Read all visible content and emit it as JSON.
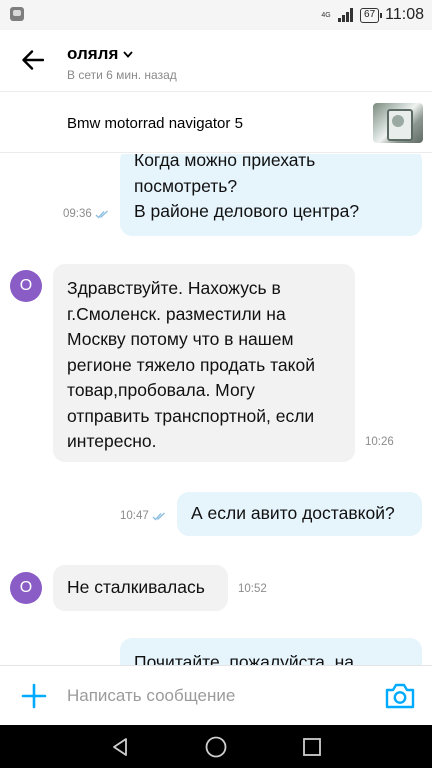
{
  "status_bar": {
    "network": "4G",
    "battery": "67",
    "time": "11:08"
  },
  "header": {
    "contact_name": "оляля",
    "online_status": "В сети 6 мин. назад"
  },
  "item": {
    "title": "Bmw motorrad navigator 5"
  },
  "messages": [
    {
      "direction": "out",
      "lines": [
        "Когда можно приехать",
        "посмотреть?",
        "В районе делового центра?"
      ],
      "time": "09:36",
      "read": true
    },
    {
      "direction": "in",
      "avatar_letter": "О",
      "lines": [
        "Здравствуйте. Нахожусь в",
        "г.Смоленск. разместили на",
        "Москву потому что в нашем",
        "регионе тяжело продать такой",
        "товар,пробовала. Могу",
        "отправить транспортной, если",
        "интересно."
      ],
      "time": "10:26"
    },
    {
      "direction": "out",
      "lines": [
        "А если авито доставкой?"
      ],
      "time": "10:47",
      "read": true
    },
    {
      "direction": "in",
      "avatar_letter": "О",
      "lines": [
        "Не сталкивалась"
      ],
      "time": "10:52"
    },
    {
      "direction": "out",
      "lines": [
        "Почитайте, пожалуйста, на"
      ]
    }
  ],
  "composer": {
    "placeholder": "Написать сообщение"
  },
  "colors": {
    "accent": "#00aaff",
    "outgoing_bubble": "#e6f4fc",
    "incoming_bubble": "#f2f2f2",
    "avatar": "#8a5cc6"
  },
  "icons": {
    "back": "arrow-left-icon",
    "dropdown": "chevron-down-icon",
    "read": "double-check-icon",
    "attach": "plus-icon",
    "camera": "camera-icon",
    "nav_back": "triangle-back-icon",
    "nav_home": "circle-home-icon",
    "nav_recents": "square-recents-icon"
  }
}
